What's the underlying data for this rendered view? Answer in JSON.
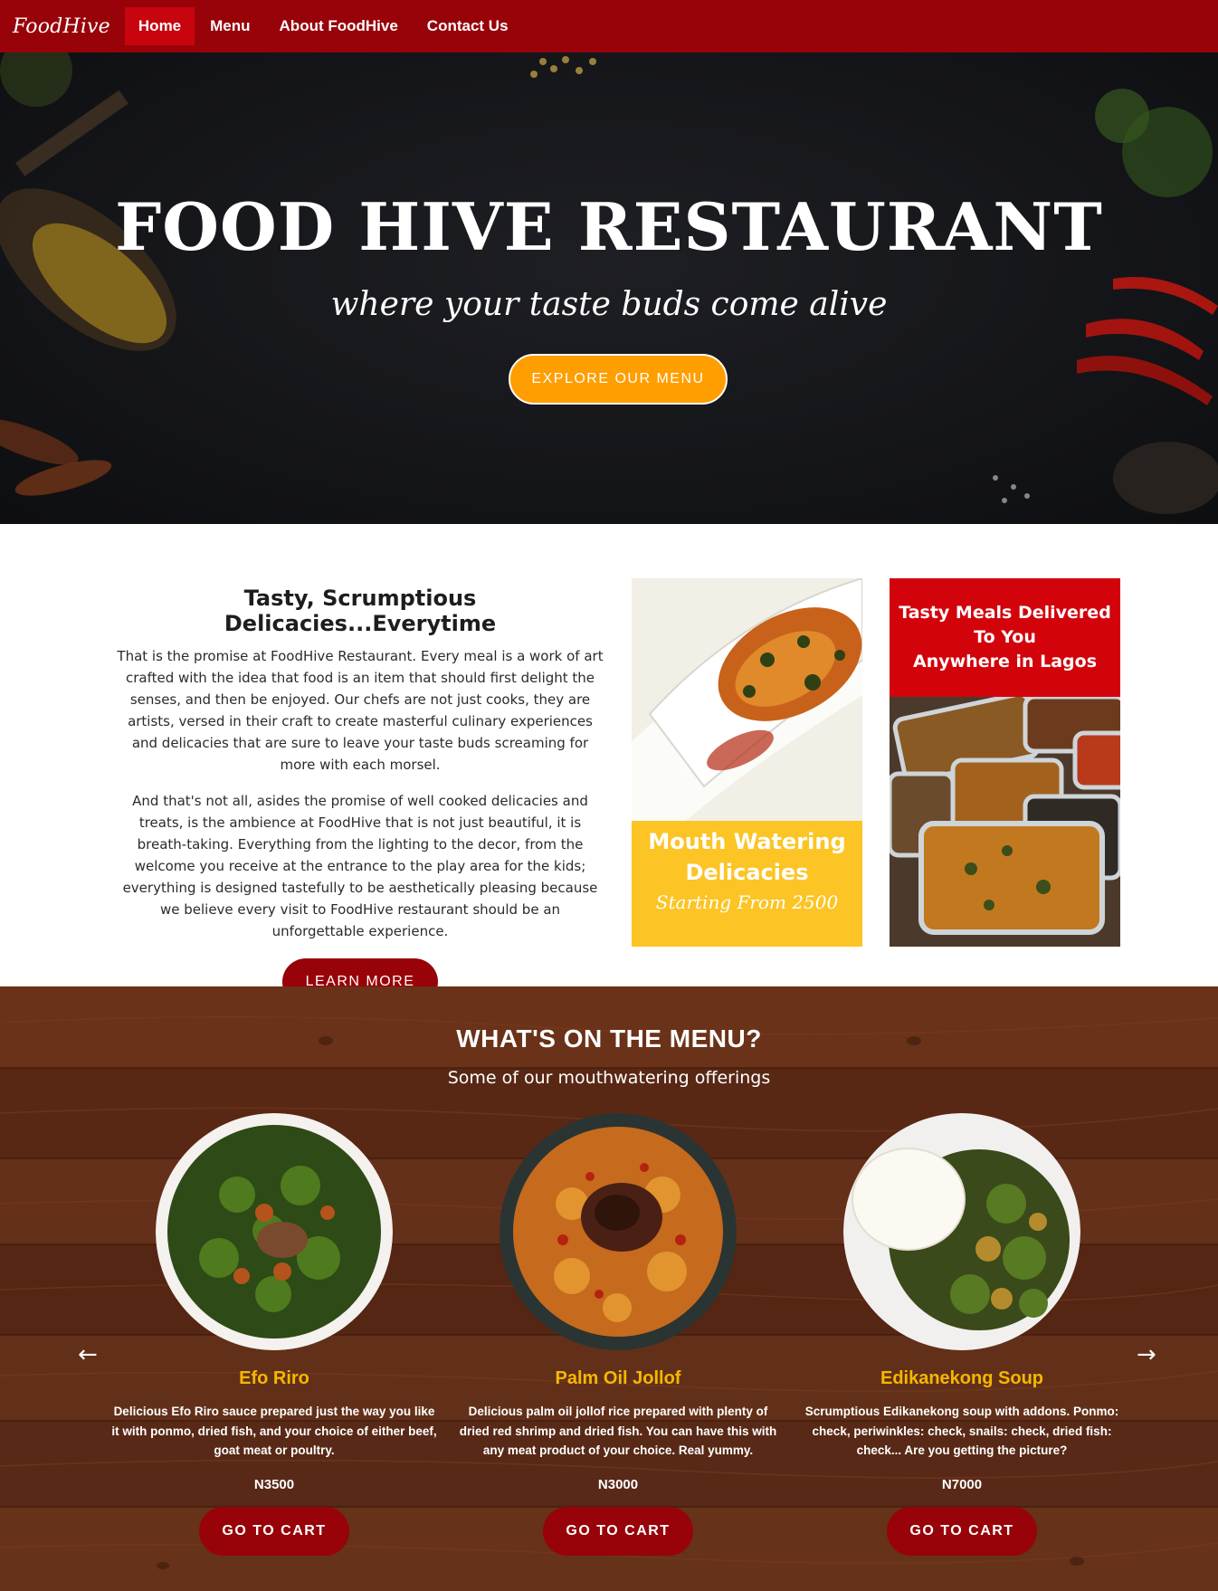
{
  "navbar": {
    "brand": "FoodHive",
    "items": [
      {
        "label": "Home",
        "active": true
      },
      {
        "label": "Menu",
        "active": false
      },
      {
        "label": "About FoodHive",
        "active": false
      },
      {
        "label": "Contact Us",
        "active": false
      }
    ]
  },
  "hero": {
    "title": "FOOD HIVE RESTAURANT",
    "subtitle": "where your taste buds come alive",
    "cta_label": "EXPLORE OUR MENU"
  },
  "about": {
    "heading": "Tasty, Scrumptious Delicacies...Everytime",
    "paragraph1": "That is the promise at FoodHive Restaurant. Every meal is a work of art crafted with the idea that food is an item that should first delight the senses, and then be enjoyed. Our chefs are not just cooks, they are artists, versed in their craft to create masterful culinary experiences and delicacies that are sure to leave your taste buds screaming for more with each morsel.",
    "paragraph2": "And that's not all, asides the promise of well cooked delicacies and treats, is the ambience at FoodHive that is not just beautiful, it is breath-taking. Everything from the lighting to the decor, from the welcome you receive at the entrance to the play area for the kids; everything is designed tastefully to be aesthetically pleasing because we believe every visit to FoodHive restaurant should be an unforgettable experience.",
    "button_label": "LEARN MORE"
  },
  "promos": {
    "mouth_watering": {
      "line1": "Mouth Watering",
      "line2": "Delicacies",
      "line3": "Starting From 2500"
    },
    "delivery": {
      "line1": "Tasty Meals Delivered",
      "line2": "To You",
      "line3": "Anywhere in Lagos"
    }
  },
  "menu": {
    "title": "WHAT'S ON THE MENU?",
    "subtitle": "Some of our mouthwatering offerings",
    "prev_arrow": "←",
    "next_arrow": "→",
    "items": [
      {
        "name": "Efo Riro",
        "description": "Delicious Efo Riro sauce prepared just the way you like it with ponmo, dried fish, and your choice of either beef, goat meat or poultry.",
        "price": "N3500",
        "button_label": "GO TO CART"
      },
      {
        "name": "Palm Oil Jollof",
        "description": "Delicious palm oil jollof rice prepared with plenty of dried red shrimp and dried fish. You can have this with any meat product of your choice. Real yummy.",
        "price": "N3000",
        "button_label": "GO TO CART"
      },
      {
        "name": "Edikanekong Soup",
        "description": "Scrumptious Edikanekong soup with addons. Ponmo: check, periwinkles: check, snails: check, dried fish: check... Are you getting the picture?",
        "price": "N7000",
        "button_label": "GO TO CART"
      }
    ]
  },
  "colors": {
    "primary_red": "#980209",
    "active_red": "#c8040e",
    "accent_orange": "#ff9e00",
    "accent_yellow": "#fcc425",
    "menu_item_name": "#f5b800"
  }
}
